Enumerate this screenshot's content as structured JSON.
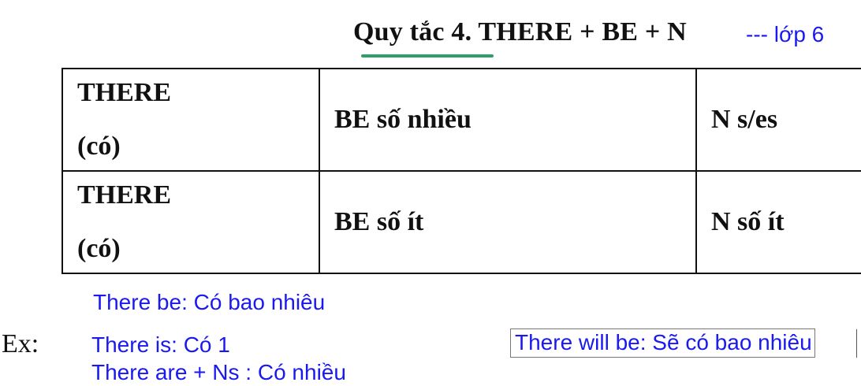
{
  "title": "Quy tắc 4. THERE + BE + N",
  "grade_note": "--- lớp 6",
  "colors": {
    "accent_blue": "#1a1af0",
    "underline_green": "#2e9e6b"
  },
  "table": {
    "rows": [
      {
        "subject": "THERE",
        "subject_note": "(có)",
        "verb": "BE số nhiều",
        "noun": "N s/es"
      },
      {
        "subject": "THERE",
        "subject_note": "(có)",
        "verb": "BE số ít",
        "noun": "N số ít"
      }
    ]
  },
  "notes": {
    "there_be": "There be: Có bao nhiêu",
    "ex_label": "Ex:",
    "there_is": "There is: Có 1",
    "there_are": "There are + Ns : Có nhiều",
    "there_will_be": "There will be: Sẽ có bao nhiêu"
  }
}
